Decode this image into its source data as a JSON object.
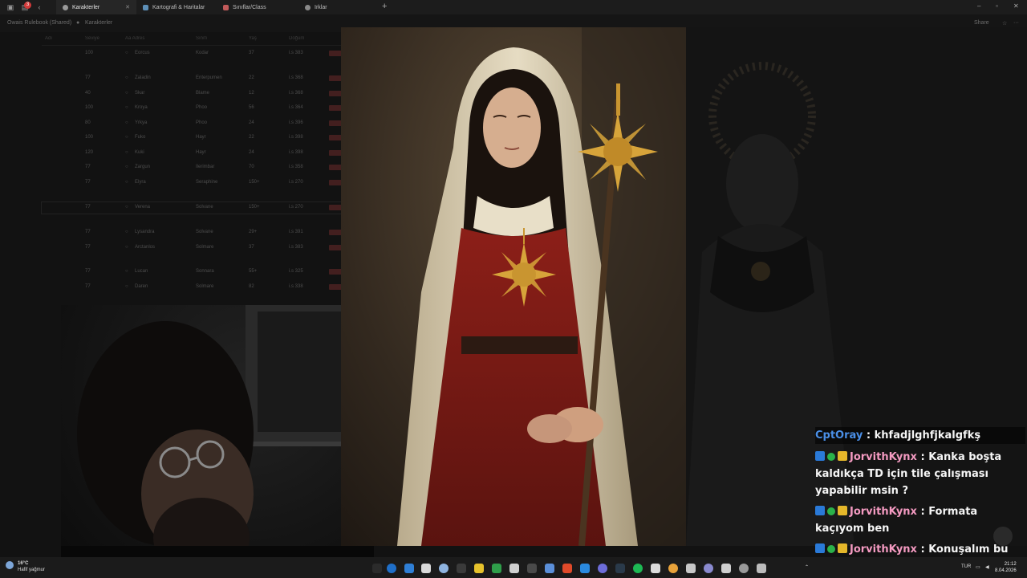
{
  "browser": {
    "notif_count": "3",
    "tabs": [
      {
        "label": "Karakterler",
        "color": "#9a9a9a"
      },
      {
        "label": "Kartografi & Haritalar",
        "color": "#5d8fb7"
      },
      {
        "label": "Sınıflar/Class",
        "color": "#c15a5a"
      },
      {
        "label": "Irklar",
        "color": "#8a8a8a"
      }
    ]
  },
  "header": {
    "workspace": "Owais Rulebook (Shared)",
    "page": "Karakterler",
    "share": "Share"
  },
  "table": {
    "columns": [
      "Adı",
      "Seviye",
      "Aa Adres",
      "Sınıfı",
      "Yaş",
      "Doğum"
    ],
    "rows": [
      {
        "lvl": "100",
        "name": "Eorcus",
        "cls": "Kodar",
        "age": "37",
        "dob": "i.s 383"
      },
      {
        "lvl": "77",
        "name": "Zaladin",
        "cls": "Enterpumen",
        "age": "22",
        "dob": "i.s 368"
      },
      {
        "lvl": "40",
        "name": "Skar",
        "cls": "Blame",
        "age": "12",
        "dob": "i.s 368"
      },
      {
        "lvl": "100",
        "name": "Kroya",
        "cls": "Phoo",
        "age": "56",
        "dob": "i.s 364"
      },
      {
        "lvl": "80",
        "name": "Yrkya",
        "cls": "Phoo",
        "age": "24",
        "dob": "i.s 396"
      },
      {
        "lvl": "100",
        "name": "Fuko",
        "cls": "Hayr",
        "age": "22",
        "dob": "i.s 398"
      },
      {
        "lvl": "120",
        "name": "Kuki",
        "cls": "Hayr",
        "age": "24",
        "dob": "i.s 398"
      },
      {
        "lvl": "77",
        "name": "Zargun",
        "cls": "Ilerimbar",
        "age": "70",
        "dob": "i.s 358"
      },
      {
        "lvl": "77",
        "name": "Elyra",
        "cls": "Seraphine",
        "age": "150+",
        "dob": "i.s 270"
      },
      {
        "lvl": "77",
        "name": "Verena",
        "cls": "Solvane",
        "age": "150+",
        "dob": "i.s 270"
      },
      {
        "lvl": "77",
        "name": "Lysandra",
        "cls": "Solvane",
        "age": "29+",
        "dob": "i.s 391"
      },
      {
        "lvl": "77",
        "name": "Arctanlos",
        "cls": "Solmare",
        "age": "37",
        "dob": "i.s 383"
      },
      {
        "lvl": "77",
        "name": "Lucan",
        "cls": "Sonnara",
        "age": "55+",
        "dob": "i.s 325"
      },
      {
        "lvl": "77",
        "name": "Daren",
        "cls": "Solmare",
        "age": "82",
        "dob": "i.s 338"
      }
    ]
  },
  "chat": {
    "messages": [
      {
        "user": "CptOray",
        "text": "khfadjlghfjkalgfkş"
      },
      {
        "user": "JorvithKynx",
        "text": "Kanka boşta kaldıkça TD için tile çalışması yapabilir msin ?"
      },
      {
        "user": "JorvithKynx",
        "text": "Formata kaçıyom ben"
      },
      {
        "user": "JorvithKynx",
        "text": "Konuşalım bu konuları"
      }
    ],
    "separator": " : "
  },
  "taskbar": {
    "temp": "16°C",
    "weather": "Hafif yağmur",
    "lang": "TUR",
    "time": "21:12",
    "date": "8.04.2026"
  }
}
